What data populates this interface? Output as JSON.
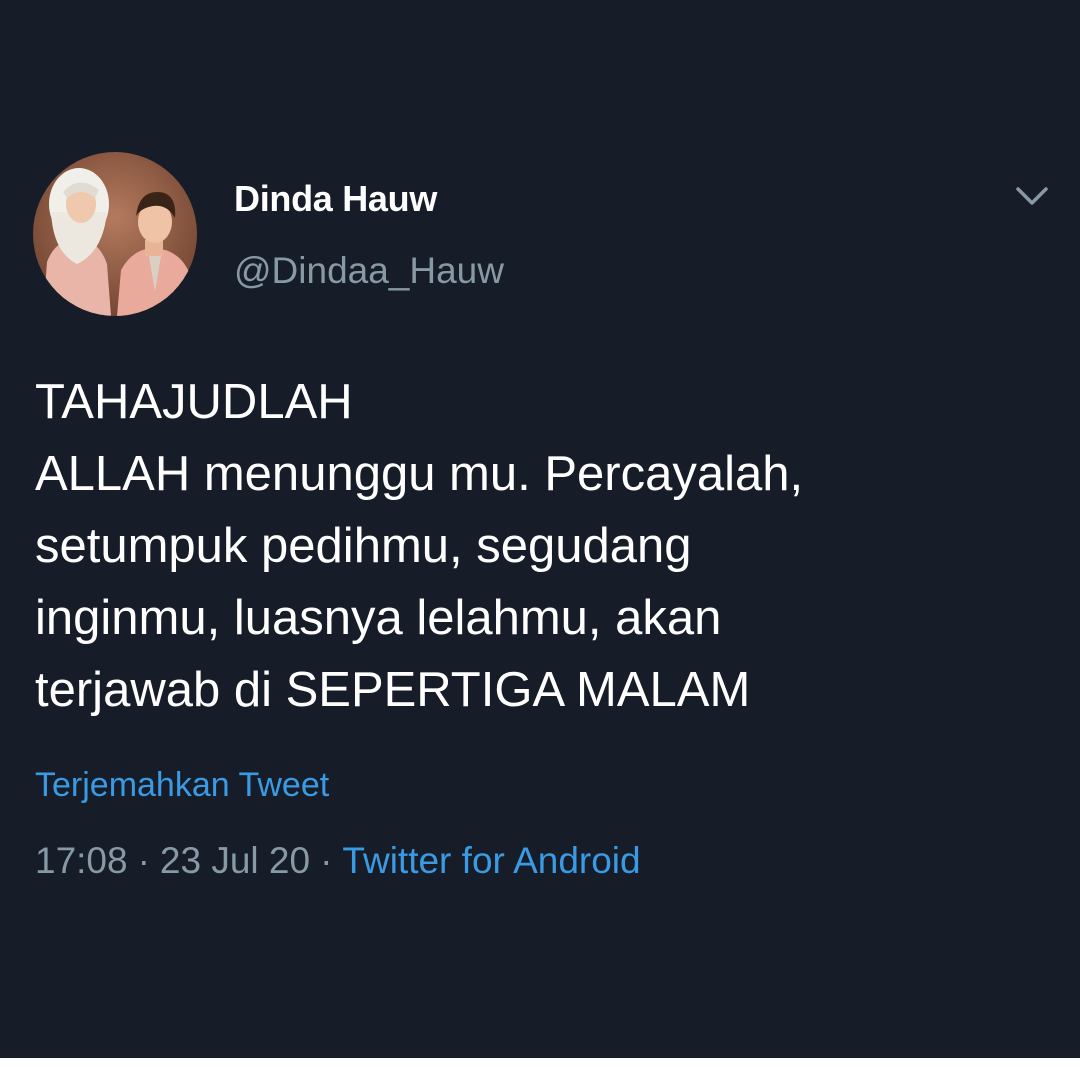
{
  "tweet": {
    "author": {
      "display_name": "Dinda Hauw",
      "handle": "@Dindaa_Hauw",
      "avatar_icon": "profile-photo"
    },
    "menu_icon": "chevron-down-icon",
    "text_lines": [
      "TAHAJUDLAH",
      "ALLAH menunggu mu. Percayalah,",
      "setumpuk pedihmu, segudang",
      "inginmu, luasnya lelahmu, akan",
      "terjawab di SEPERTIGA MALAM"
    ],
    "translate_label": "Terjemahkan Tweet",
    "time": "17:08",
    "separator": "·",
    "date": "23 Jul 20",
    "source": "Twitter for Android"
  },
  "colors": {
    "background": "#161d28",
    "text_primary": "#ffffff",
    "text_secondary": "#8899a6",
    "link": "#3a9ae3"
  }
}
